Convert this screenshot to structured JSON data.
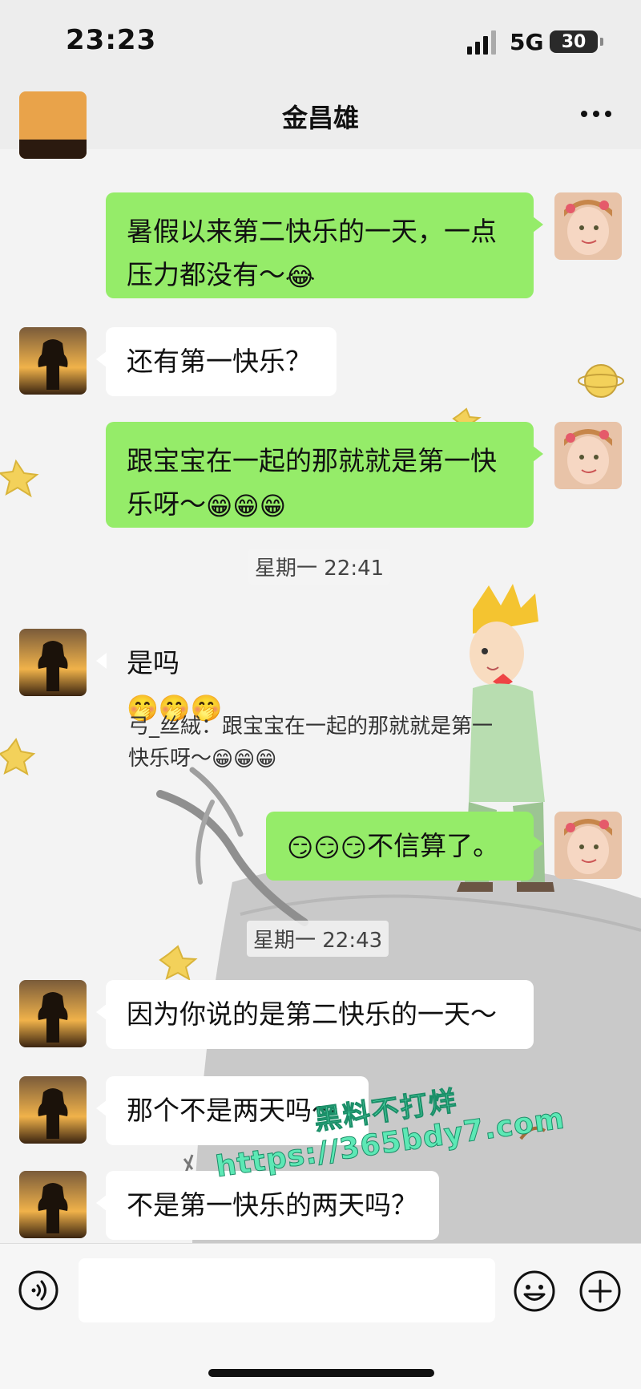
{
  "status_bar": {
    "time": "23:23",
    "network": "5G",
    "battery": "30"
  },
  "header": {
    "title": "金昌雄",
    "back_icon": "chevron-left-icon",
    "more_icon": "more-dots-icon"
  },
  "messages": [
    {
      "side": "right",
      "text": "暑假以来第二快乐的一天，一点压力都没有～",
      "emojis": "😂"
    },
    {
      "side": "left",
      "text": "还有第一快乐？",
      "emojis": ""
    },
    {
      "side": "right",
      "text": "跟宝宝在一起的那就就是第一快乐呀～",
      "emojis": "😁😁😁"
    },
    {
      "type": "timestamp",
      "text": "星期一 22:41"
    },
    {
      "side": "left",
      "text": "是吗",
      "emojis": "🤭🤭🤭"
    },
    {
      "type": "quote",
      "text": "弓_丝絨：跟宝宝在一起的那就就是第一快乐呀～",
      "emojis": "😁😁😁"
    },
    {
      "side": "right",
      "text": "不信算了。",
      "emojis": "😏😏😏"
    },
    {
      "type": "timestamp",
      "text": "星期一 22:43"
    },
    {
      "side": "left",
      "text": "因为你说的是第二快乐的一天～",
      "emojis": ""
    },
    {
      "side": "left",
      "text": "那个不是两天吗～",
      "emojis": ""
    },
    {
      "side": "left",
      "text": "不是第一快乐的两天吗？",
      "emojis": ""
    }
  ],
  "watermark": {
    "line1": "黑料不打烊",
    "line2": "https://365bdy7.com"
  },
  "input_bar": {
    "voice_icon": "voice-icon",
    "emoji_icon": "smiley-icon",
    "plus_icon": "plus-icon",
    "input_value": ""
  },
  "colors": {
    "sent_bubble": "#95ec69",
    "received_bubble": "#ffffff",
    "background": "#ededed"
  }
}
